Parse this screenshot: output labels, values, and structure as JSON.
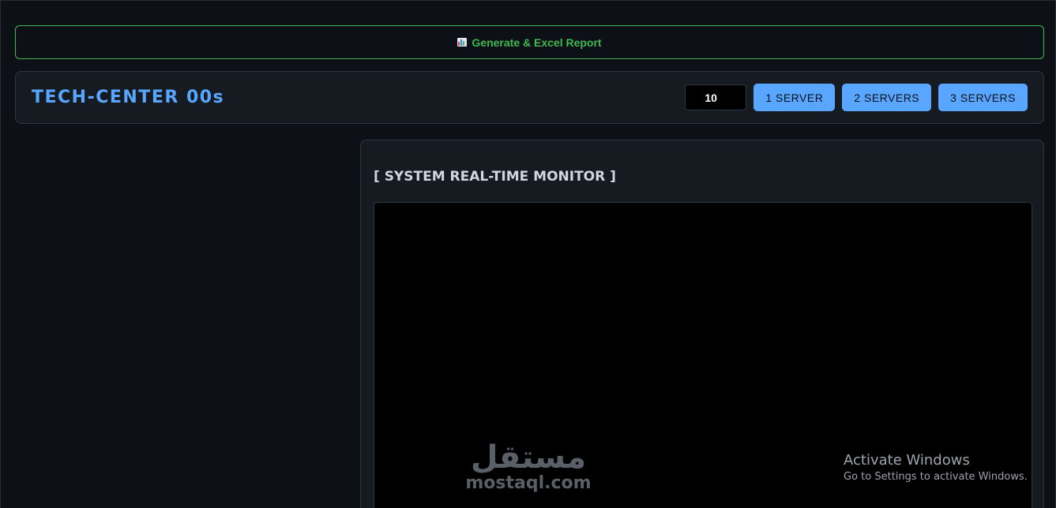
{
  "report_button": {
    "label": "Generate & Excel Report",
    "icon": "bar-chart-icon"
  },
  "header": {
    "brand": "TECH-CENTER 00s",
    "count_value": "10",
    "server_buttons": [
      "1 SERVER",
      "2 SERVERS",
      "3 SERVERS"
    ],
    "accent_color": "#58a6ff"
  },
  "monitor": {
    "title": "[ SYSTEM REAL-TIME MONITOR ]"
  },
  "watermark": {
    "arabic": "مستقل",
    "latin": "mostaql.com"
  },
  "os_notice": {
    "title": "Activate Windows",
    "subtitle": "Go to Settings to activate Windows."
  },
  "colors": {
    "success": "#3fb950",
    "background": "#0d1016",
    "panel": "#161b22"
  }
}
